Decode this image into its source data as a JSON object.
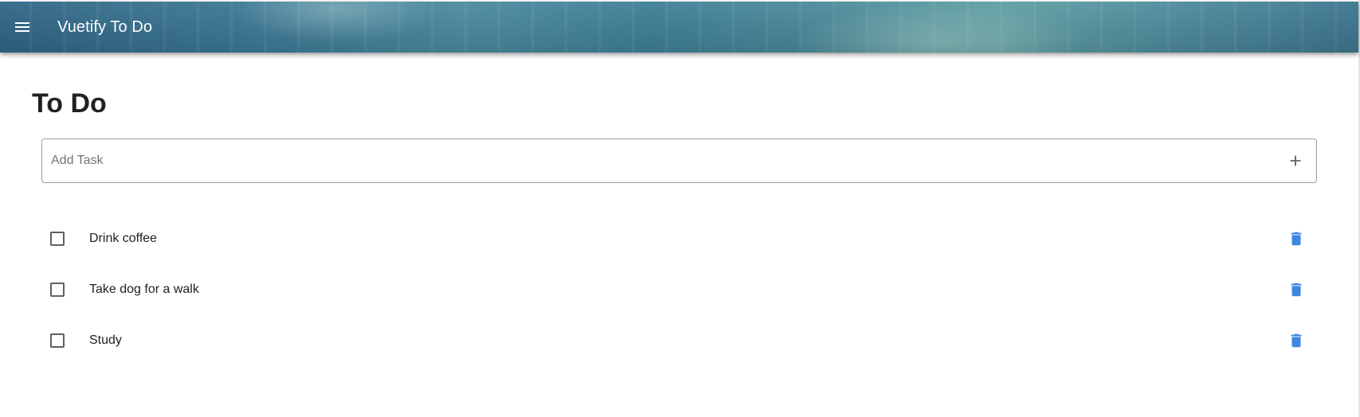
{
  "app_bar": {
    "title": "Vuetify To Do",
    "menu_icon": "menu-icon"
  },
  "main": {
    "heading": "To Do",
    "add_task": {
      "placeholder": "Add Task",
      "value": "",
      "add_icon": "plus-icon"
    },
    "tasks": [
      {
        "label": "Drink coffee",
        "done": false
      },
      {
        "label": "Take dog for a walk",
        "done": false
      },
      {
        "label": "Study",
        "done": false
      }
    ]
  },
  "colors": {
    "delete_icon": "#3f86e0",
    "app_bar_start": "#2f6686",
    "app_bar_end": "#3c7690"
  }
}
